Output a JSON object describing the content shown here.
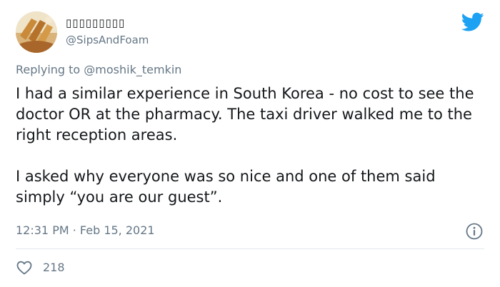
{
  "user": {
    "display_name": "▯▯▯▯▯▯▯▯▯",
    "handle": "@SipsAndFoam"
  },
  "reply": {
    "prefix": "Replying to",
    "handle": "@moshik_temkin"
  },
  "tweet": {
    "paragraphs": [
      "I had a similar experience in South Korea - no cost to see the doctor OR at the pharmacy. The taxi driver walked me to the right reception areas.",
      "I asked why everyone was so nice and one of them said simply “you are our guest”."
    ],
    "timestamp": "12:31 PM · Feb 15, 2021"
  },
  "stats": {
    "likes": "218"
  },
  "icons": {
    "brand": "twitter-bird-icon",
    "info": "info-icon",
    "like": "heart-icon"
  },
  "colors": {
    "twitter_blue": "#1da1f2",
    "secondary_text": "#657786",
    "primary_text": "#14171a",
    "divider": "#e1e8ed"
  }
}
